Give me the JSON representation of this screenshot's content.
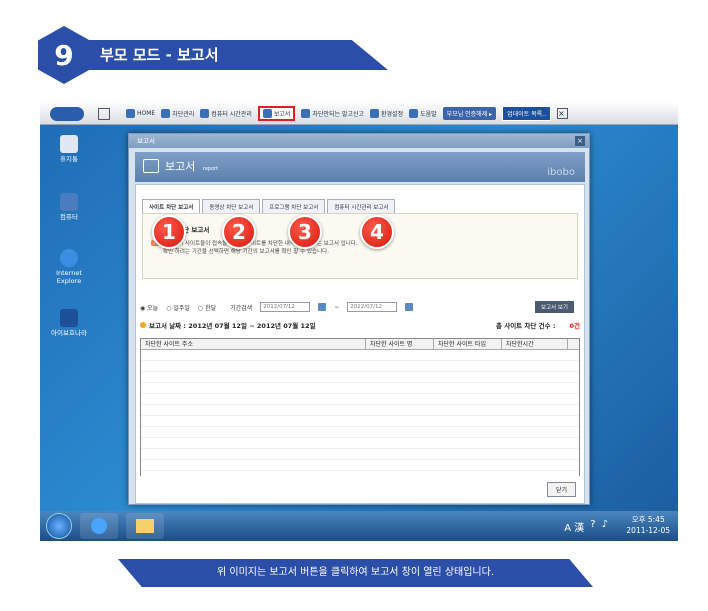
{
  "header": {
    "step_number": "9",
    "title": "부모 모드 - 보고서"
  },
  "toolbar": {
    "home": "HOME",
    "block_manage": "차단관리",
    "pc_time": "컴퓨터 시간관리",
    "report": "보고서",
    "blocked_report": "차단안되는 말고신고",
    "settings": "환경설정",
    "help": "도움말",
    "auth_button": "부모님 인증해제 ▸",
    "update_button": "업데이트 목록.."
  },
  "desktop_icons": [
    "휴지통",
    "컴퓨터",
    "Internet Explore",
    "아이보호나라"
  ],
  "dialog": {
    "title": "보고서",
    "banner_title": "보고서",
    "banner_sub": "report",
    "brand": "ibobo",
    "tabs": [
      "사이트 차단 보고서",
      "동영상 차단 보고서",
      "프로그램 차단 보고서",
      "컴퓨터 시간관리 보고서"
    ],
    "info_title": "사이트 차단 보고서",
    "tip_label": "TIP",
    "info_line1": "자녀분이 사이트들이 접속을 시도한 사이트를 차단한 내역을 보여주는 보고서 입니다.",
    "info_line2": "확인 하려는 기간을 선택하면 해당 기간의 보고서를 확인 할 수 있습니다.",
    "numbers": [
      "1",
      "2",
      "3",
      "4"
    ],
    "radio_options": [
      "오늘",
      "일주일",
      "한달"
    ],
    "period_label": "기간검색",
    "date_from": "2012/07/12",
    "date_to": "2012/07/12",
    "view_button": "보고서 보기",
    "report_date": "보고서 날짜 : 2012년 07월 12일 ~ 2012년 07월 12일",
    "total_label": "총 사이트 차단 건수 :",
    "total_value": "0건",
    "columns": [
      "차단한 사이트 주소",
      "차단한 사이트 명",
      "차단한 사이트 타입",
      "차단한시간"
    ],
    "close_button": "닫기"
  },
  "taskbar": {
    "time": "오후 5:45",
    "date": "2011-12-05",
    "ime": "A 漢"
  },
  "caption": "위 이미지는 보고서 버튼을 클릭하여 보고서 창이 열린 상태입니다."
}
